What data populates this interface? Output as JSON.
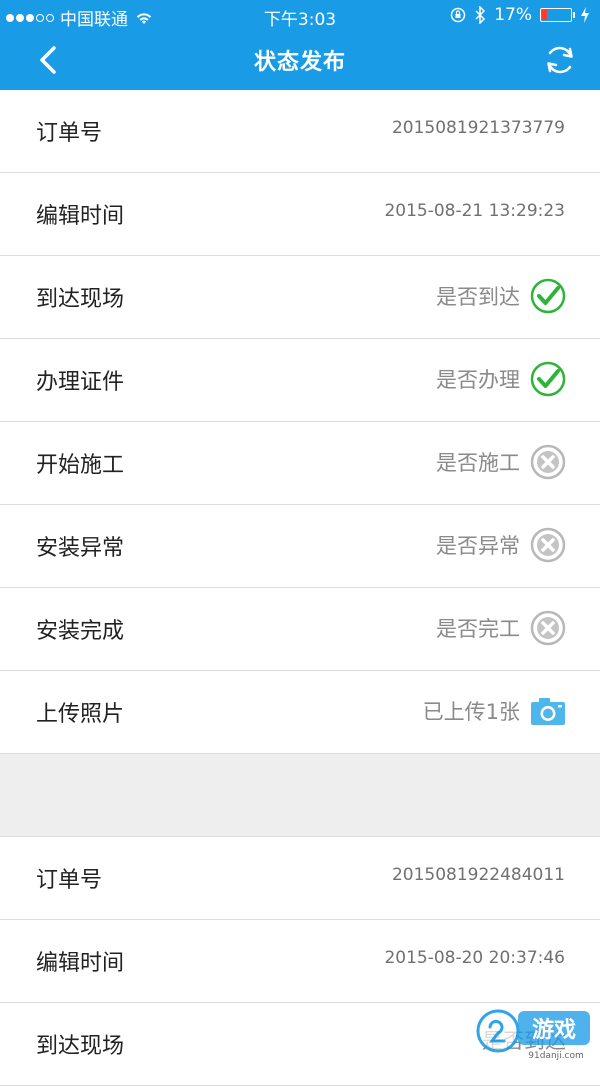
{
  "status_bar": {
    "carrier": "中国联通",
    "time": "下午3:03",
    "battery": "17%",
    "battery_level": 0.17
  },
  "nav": {
    "title": "状态发布"
  },
  "colors": {
    "brand": "#1a9be6",
    "check_green": "#2fb43a",
    "cross_gray": "#b8b8b8",
    "camera_blue": "#4fb6ec"
  },
  "orders": [
    {
      "order_label": "订单号",
      "order_no": "2015081921373779",
      "time_label": "编辑时间",
      "time_value": "2015-08-21 13:29:23",
      "steps": [
        {
          "label": "到达现场",
          "status_text": "是否到达",
          "state": "done",
          "icon": "check-circle-icon"
        },
        {
          "label": "办理证件",
          "status_text": "是否办理",
          "state": "done",
          "icon": "check-circle-icon"
        },
        {
          "label": "开始施工",
          "status_text": "是否施工",
          "state": "pending",
          "icon": "cross-circle-icon"
        },
        {
          "label": "安装异常",
          "status_text": "是否异常",
          "state": "pending",
          "icon": "cross-circle-icon"
        },
        {
          "label": "安装完成",
          "status_text": "是否完工",
          "state": "pending",
          "icon": "cross-circle-icon"
        }
      ],
      "photo_label": "上传照片",
      "photo_status": "已上传1张",
      "photo_icon": "camera-icon"
    },
    {
      "order_label": "订单号",
      "order_no": "2015081922484011",
      "time_label": "编辑时间",
      "time_value": "2015-08-20 20:37:46",
      "steps": [
        {
          "label": "到达现场",
          "status_text": "是否到达",
          "state": "unknown",
          "icon": ""
        }
      ]
    }
  ],
  "watermark": {
    "text": "游戏",
    "site": "91danji.com"
  }
}
